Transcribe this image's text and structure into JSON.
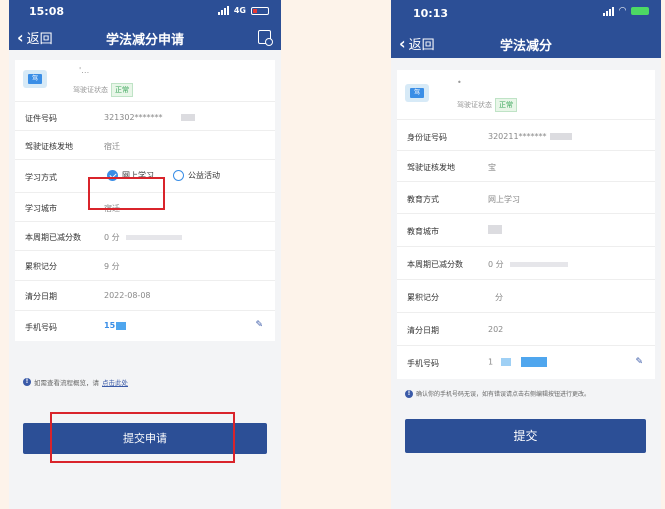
{
  "left": {
    "status": {
      "time": "15:08",
      "network": "4G"
    },
    "nav": {
      "back": "返回",
      "title": "学法减分申请"
    },
    "license": {
      "plate_icon": "驾",
      "name": "'…",
      "status_label": "驾驶证状态",
      "status_badge": "正常"
    },
    "rows": [
      {
        "label": "证件号码",
        "value": "321302*******"
      },
      {
        "label": "驾驶证核发地",
        "value": "宿迁"
      },
      {
        "label": "学习方式",
        "value": ""
      },
      {
        "label": "学习城市",
        "value": "宿迁"
      },
      {
        "label": "本周期已减分数",
        "value": "0 分"
      },
      {
        "label": "累积记分",
        "value": "9 分"
      },
      {
        "label": "清分日期",
        "value": "2022-08-08"
      },
      {
        "label": "手机号码",
        "value": "15"
      }
    ],
    "study_options": [
      {
        "label": "网上学习",
        "selected": true
      },
      {
        "label": "公益活动",
        "selected": false
      }
    ],
    "tip": {
      "text": "如需查看流程概览，请",
      "link": "点击此处"
    },
    "submit_label": "提交申请"
  },
  "right": {
    "status": {
      "time": "10:13"
    },
    "nav": {
      "back": "返回",
      "title": "学法减分"
    },
    "license": {
      "plate_icon": "驾",
      "name": "•",
      "status_label": "驾驶证状态",
      "status_badge": "正常"
    },
    "rows": [
      {
        "label": "身份证号码",
        "value": "320211*******"
      },
      {
        "label": "驾驶证核发地",
        "value": "宝"
      },
      {
        "label": "教育方式",
        "value": "网上学习"
      },
      {
        "label": "教育城市",
        "value": ""
      },
      {
        "label": "本周期已减分数",
        "value": "0 分"
      },
      {
        "label": "累积记分",
        "value": "分"
      },
      {
        "label": "清分日期",
        "value": "202"
      },
      {
        "label": "手机号码",
        "value": "1"
      }
    ],
    "tip": {
      "text": "确认你的手机号码无误，如有错误请点击右侧编辑按钮进行更改。"
    },
    "submit_label": "提交"
  },
  "colors": {
    "primary": "#2c4f96",
    "highlight": "#d9242b",
    "page_bg": "#fdf3ea",
    "badge_green": "#3aa65a"
  },
  "icons": {
    "back": "chevron-left-icon",
    "menu": "document-search-icon",
    "edit": "pencil-icon",
    "info": "info-icon"
  }
}
